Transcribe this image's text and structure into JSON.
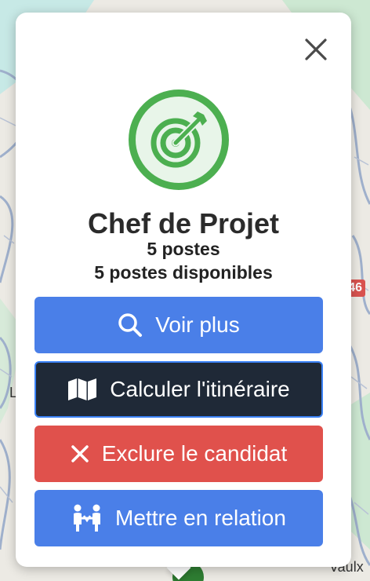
{
  "map": {
    "labels": {
      "left_letter": "L",
      "bottom_right": "Vaulx",
      "route_number": "46"
    },
    "colors": {
      "land": "#eceae4",
      "water": "#c7e9e6",
      "road": "#9fb0cc",
      "park": "#cde8d2"
    }
  },
  "popup": {
    "close_icon": "close-icon",
    "avatar_icon": "target-arrow-icon",
    "title": "Chef de Projet",
    "postes": "5 postes",
    "disponibles": "5 postes disponibles",
    "buttons": {
      "voir": {
        "label": "Voir plus",
        "icon": "search-icon",
        "color": "#4a7fe8"
      },
      "itineraire": {
        "label": "Calculer l'itinéraire",
        "icon": "map-icon",
        "color": "#1f2937"
      },
      "exclure": {
        "label": "Exclure le candidat",
        "icon": "x-icon",
        "color": "#e0514c"
      },
      "relation": {
        "label": "Mettre en relation",
        "icon": "handshake-people-icon",
        "color": "#4a7fe8"
      }
    }
  }
}
